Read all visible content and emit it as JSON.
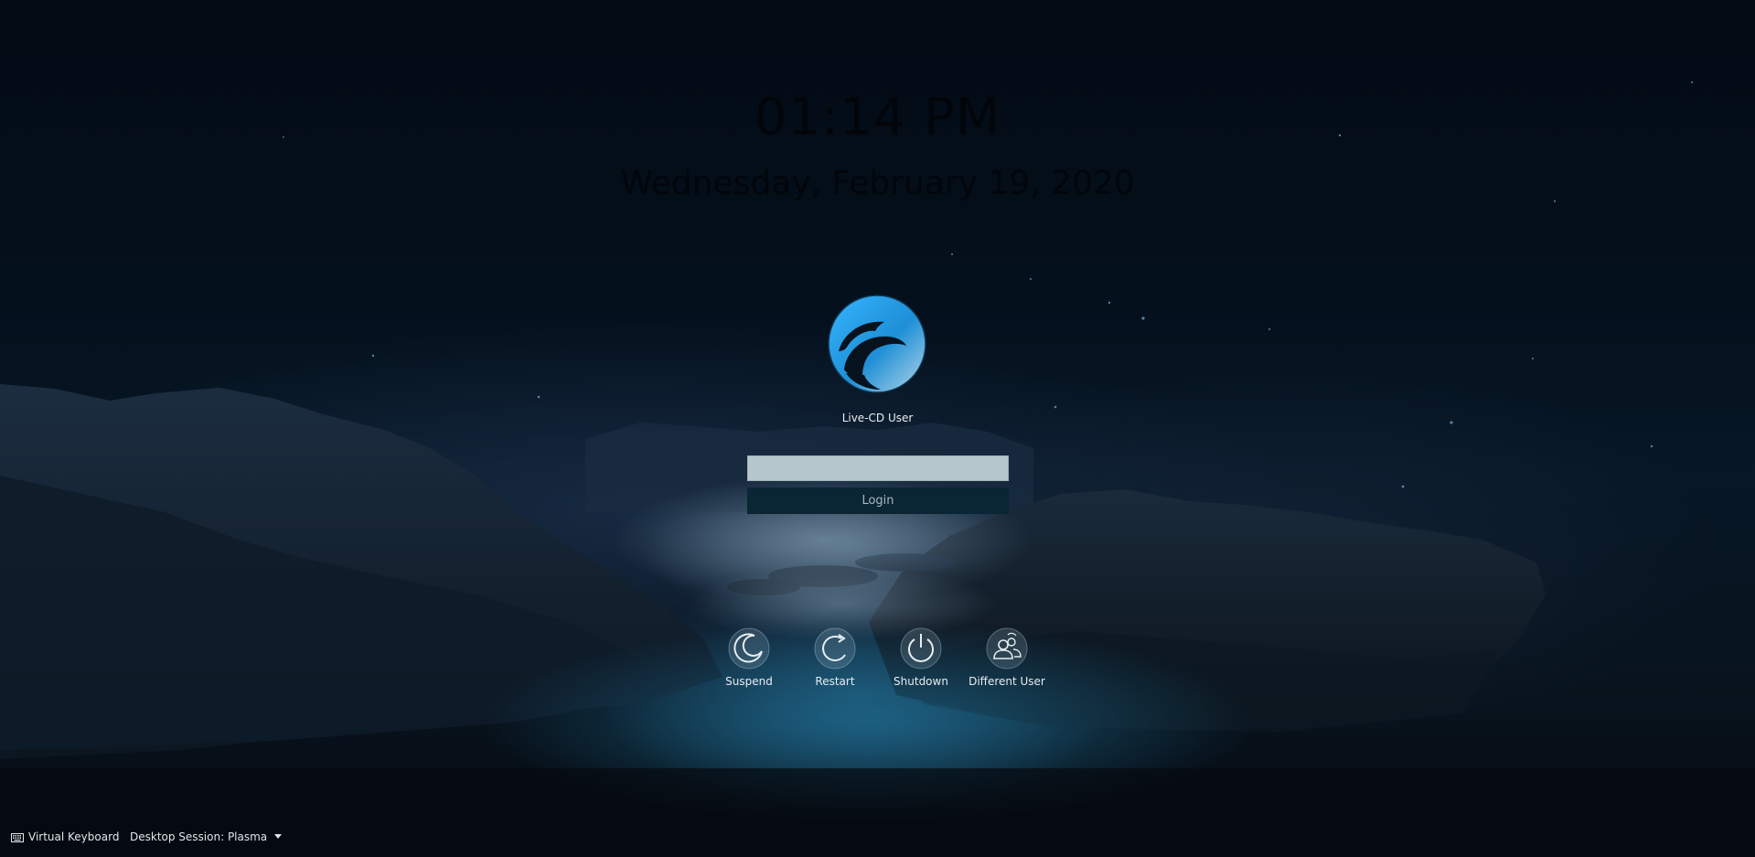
{
  "clock": {
    "time": "01:14 PM",
    "date": "Wednesday, February 19, 2020"
  },
  "user": {
    "name": "Live-CD User",
    "avatar_icon": "user-avatar-logo-icon"
  },
  "password": {
    "value": "",
    "placeholder": ""
  },
  "login": {
    "label": "Login"
  },
  "actions": [
    {
      "label": "Suspend",
      "icon": "suspend-icon"
    },
    {
      "label": "Restart",
      "icon": "restart-icon"
    },
    {
      "label": "Shutdown",
      "icon": "shutdown-icon"
    },
    {
      "label": "Different User",
      "icon": "different-user-icon"
    }
  ],
  "footer": {
    "virtual_keyboard": "Virtual Keyboard",
    "session": "Desktop Session: Plasma"
  },
  "colors": {
    "accent": "#29a0e8",
    "login_button": "#0a2533",
    "password_field": "#b5c6cd"
  }
}
